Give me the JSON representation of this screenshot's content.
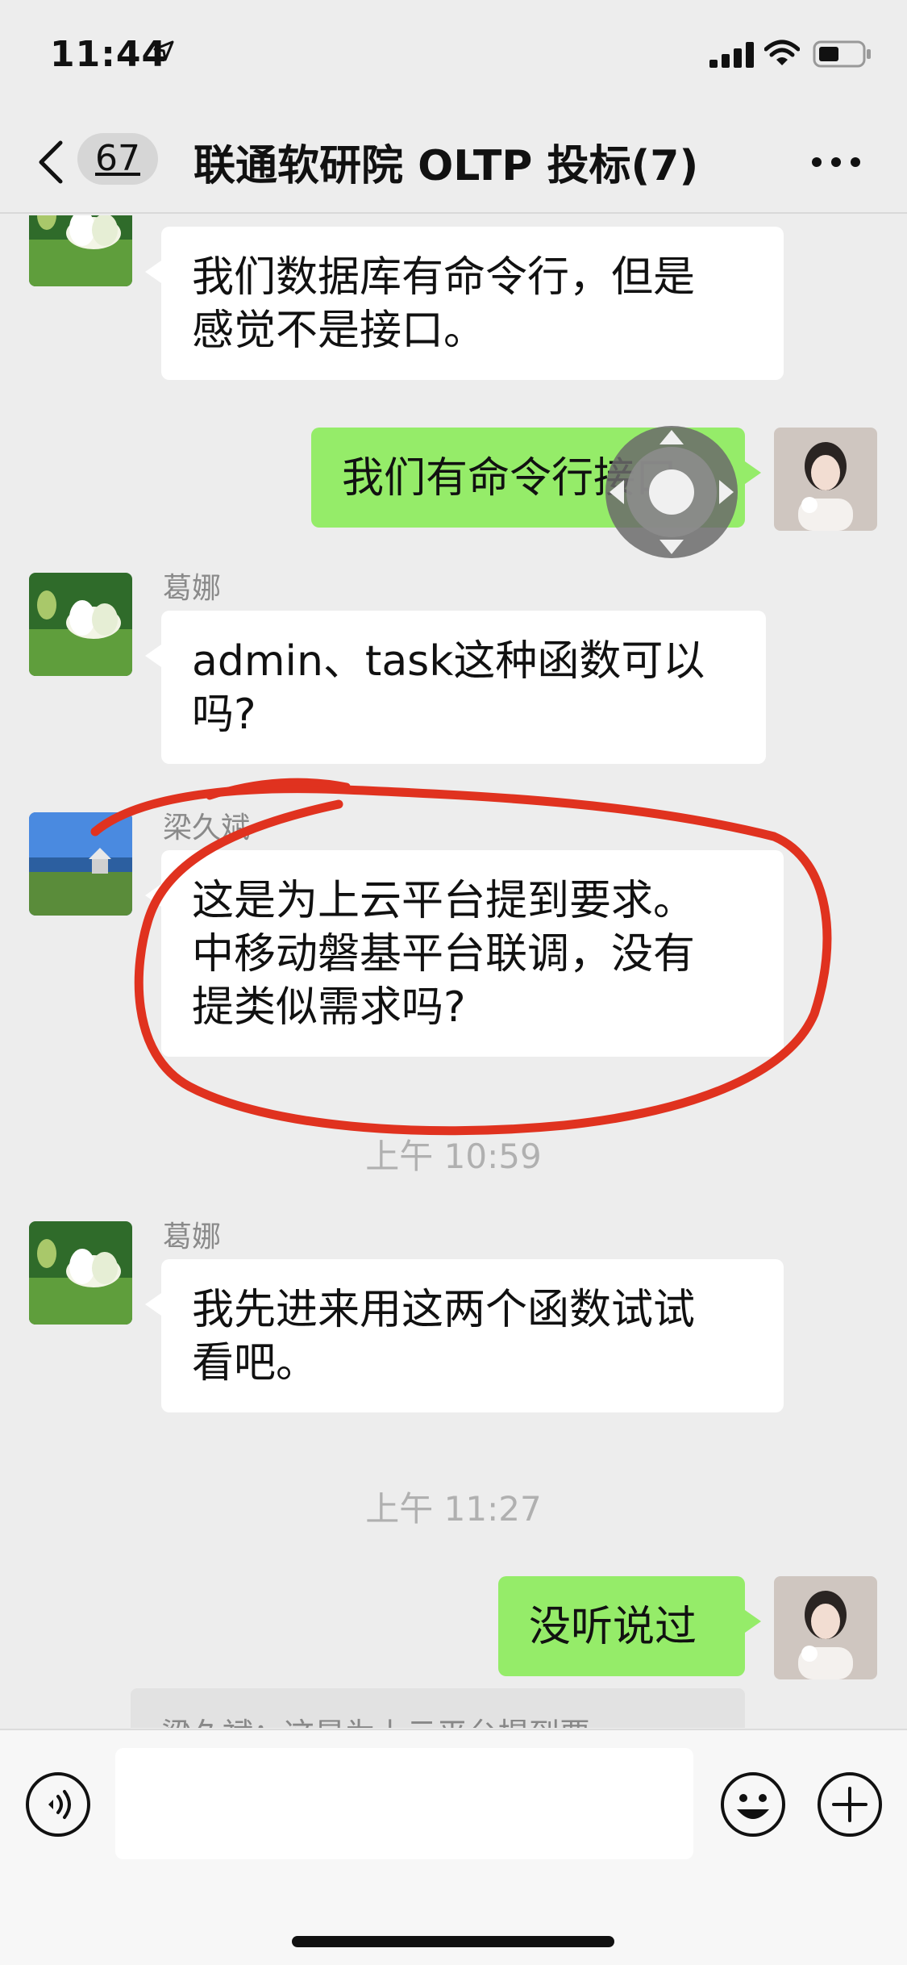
{
  "status_bar": {
    "time": "11:44"
  },
  "nav": {
    "unread_count": "67",
    "title": "联通软研院 OLTP 投标(7)"
  },
  "messages": [
    {
      "side": "in",
      "sender": "",
      "text": "我们数据库有命令行，但是\n感觉不是接口。"
    },
    {
      "side": "out",
      "sender": "",
      "text": "我们有命令行接口"
    },
    {
      "side": "in",
      "sender": "葛娜",
      "text": "admin、task这种函数可以\n吗?"
    },
    {
      "side": "in",
      "sender": "梁久斌",
      "text": "这是为上云平台提到要求。\n中移动磐基平台联调，没有\n提类似需求吗?"
    },
    {
      "side": "in",
      "sender": "葛娜",
      "text": "我先进来用这两个函数试试\n看吧。"
    },
    {
      "side": "out",
      "sender": "",
      "text": "没听说过"
    }
  ],
  "timestamps": [
    "上午 10:59",
    "上午 11:27"
  ],
  "quote_preview": "梁久斌：这是为上云平台提到要",
  "input": {
    "value": "",
    "placeholder": ""
  },
  "icons": {
    "location": "location-arrow-icon",
    "signal": "cellular-signal-icon",
    "wifi": "wifi-icon",
    "battery": "battery-icon",
    "back": "chevron-left-icon",
    "more": "more-dots-icon",
    "voice": "voice-input-icon",
    "emoji": "emoji-icon",
    "plus": "plus-icon",
    "assistive": "assistive-touch-icon"
  },
  "colors": {
    "background": "#ededed",
    "outgoing_bubble": "#95ec69",
    "incoming_bubble": "#ffffff",
    "annotation": "#e0321f"
  }
}
